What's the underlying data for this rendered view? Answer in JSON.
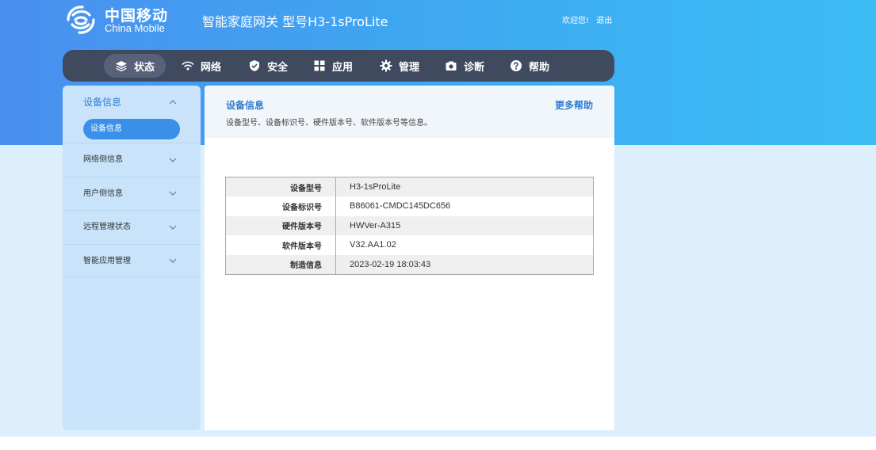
{
  "header": {
    "logo_cn": "中国移动",
    "logo_en": "China Mobile",
    "product_title": "智能家庭网关 型号H3-1sProLite",
    "welcome": "欢迎您!",
    "logout": "退出"
  },
  "nav": {
    "items": [
      {
        "label": "状态",
        "icon": "layers-icon",
        "active": true
      },
      {
        "label": "网络",
        "icon": "wifi-icon"
      },
      {
        "label": "安全",
        "icon": "shield-icon"
      },
      {
        "label": "应用",
        "icon": "grid-icon"
      },
      {
        "label": "管理",
        "icon": "gear-icon"
      },
      {
        "label": "诊断",
        "icon": "camera-icon"
      },
      {
        "label": "帮助",
        "icon": "question-icon"
      }
    ]
  },
  "sidebar": {
    "group": {
      "label": "设备信息",
      "expanded": true
    },
    "active_sub": "设备信息",
    "items": [
      {
        "label": "网络侧信息"
      },
      {
        "label": "用户侧信息"
      },
      {
        "label": "远程管理状态"
      },
      {
        "label": "智能应用管理"
      }
    ]
  },
  "content": {
    "title": "设备信息",
    "description": "设备型号、设备标识号、硬件版本号、软件版本号等信息。",
    "more_help": "更多帮助",
    "rows": [
      {
        "key": "设备型号",
        "value": "H3-1sProLite"
      },
      {
        "key": "设备标识号",
        "value": "B86061-CMDC145DC656"
      },
      {
        "key": "硬件版本号",
        "value": "HWVer-A315"
      },
      {
        "key": "软件版本号",
        "value": "V32.AA1.02"
      },
      {
        "key": "制造信息",
        "value": "2023-02-19 18:03:43"
      }
    ]
  },
  "colors": {
    "accent": "#2f7bd0",
    "nav_bg": "#404a5e",
    "active_pill": "#3a90e8",
    "sidebar_bg": "#c9e4fa"
  }
}
